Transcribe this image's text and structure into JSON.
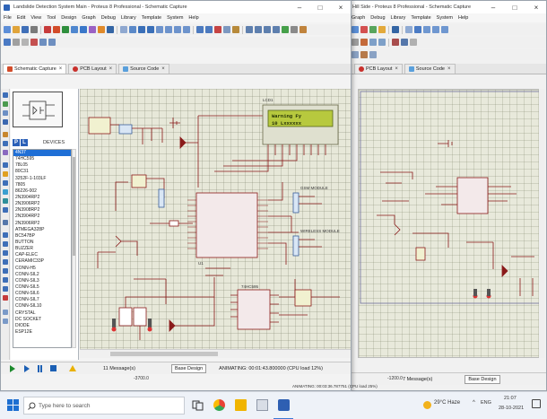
{
  "back_window": {
    "title": "Hill Side - Proteus 8 Professional - Schematic Capture",
    "menu": [
      "Graph",
      "Debug",
      "Library",
      "Template",
      "System",
      "Help"
    ],
    "tabs": [
      {
        "label": "PCB Layout"
      },
      {
        "label": "Source Code"
      }
    ],
    "status": {
      "messages": "7 Message(s)",
      "design": "Base Design",
      "coord": "-1200.0",
      "animating": "ANIMATING: 00:03:36.787751 (CPU load 25%)"
    }
  },
  "main_window": {
    "title": "Landslide Detection System Main - Proteus 8 Professional - Schematic Capture",
    "menu": [
      "File",
      "Edit",
      "View",
      "Tool",
      "Design",
      "Graph",
      "Debug",
      "Library",
      "Template",
      "System",
      "Help"
    ],
    "tabs": [
      {
        "label": "Schematic Capture"
      },
      {
        "label": "PCB Layout"
      },
      {
        "label": "Source Code"
      }
    ],
    "device_panel": {
      "label": "DEVICES",
      "picker_p": "P",
      "picker_l": "L",
      "devices": [
        "4N37",
        "74HC595",
        "78L05",
        "80C31",
        "3252F-1-103LF",
        "7805",
        "86226-002",
        "2N3904RP2",
        "2N3906RP2",
        "2N3908RP2",
        "2N3904RP2",
        "2N3906RP2",
        "ATMEGA328P",
        "BC547BP",
        "BUTTON",
        "BUZZER",
        "CAP-ELEC",
        "CERAMIC33P",
        "CONN-H5",
        "CONN-SIL2",
        "CONN-SIL3",
        "CONN-SIL5",
        "CONN-SIL6",
        "CONN-SIL7",
        "CONN-SIL10",
        "CRYSTAL",
        "DC SOCKET",
        "DIODE",
        "ESP12E"
      ],
      "selected": "4N37"
    },
    "schematic": {
      "lcd_text_line1": "Warning Fy",
      "lcd_text_line2": "10 Lxxxxxx",
      "lcd_label": "LCD1",
      "mcu_label": "U1",
      "ic_label": "74HC595",
      "module_labels": [
        "GSM MODULE",
        "WIRELESS MODULE"
      ]
    },
    "status": {
      "messages": "11 Message(s)",
      "design": "Base Design",
      "animating": "ANIMATING: 00:01:43.800000 (CPU load 12%)",
      "coord": "-3700.0"
    }
  },
  "taskbar": {
    "search_placeholder": "Type here to search",
    "weather": "29°C Haze",
    "lang": "ENG",
    "time": "21:07",
    "date": "28-10-2021"
  },
  "colors": {
    "canvas": "#e7e8d9",
    "wire": "#8a1a1a",
    "lcd_screen": "#b7c93e",
    "accent": "#1f6fd6"
  }
}
